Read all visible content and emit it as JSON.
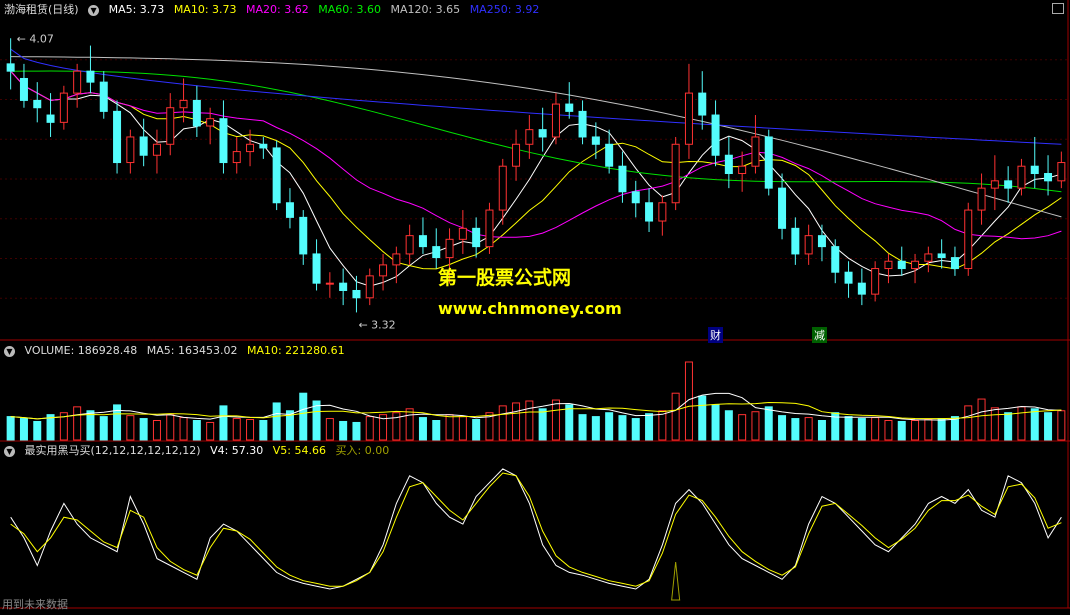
{
  "price_header": {
    "title": "渤海租赁(日线)",
    "ma5": "MA5: 3.73",
    "ma10": "MA10: 3.73",
    "ma20": "MA20: 3.62",
    "ma60": "MA60: 3.60",
    "ma120": "MA120: 3.65",
    "ma250": "MA250: 3.92"
  },
  "volume_header": {
    "label": "VOLUME: 186928.48",
    "ma5": "MA5: 163453.02",
    "ma10": "MA10: 221280.61"
  },
  "indicator_header": {
    "label": "最实用黑马买(12,12,12,12,12,12)",
    "v4": "V4: 57.30",
    "v5": "V5: 54.66",
    "buy": "买入: 0.00"
  },
  "annotations": {
    "high": "4.07",
    "low": "3.32",
    "tag1": "财",
    "tag2": "减"
  },
  "watermark": {
    "line1": "第一股票公式网",
    "line2": "www.chnmoney.com"
  },
  "footer": "用到未来数据",
  "colors": {
    "up": "#ff3232",
    "down": "#54fcfc",
    "ma5": "#ffffff",
    "ma10": "#ffff00",
    "ma20": "#ff00ff",
    "ma60": "#00e000",
    "ma120": "#c0c0c0",
    "ma250": "#3030ff"
  },
  "chart_data": {
    "type": "candlestick",
    "prices": [
      [
        4.0,
        4.07,
        3.93,
        3.98
      ],
      [
        3.96,
        4.0,
        3.88,
        3.9
      ],
      [
        3.9,
        3.95,
        3.84,
        3.88
      ],
      [
        3.86,
        3.92,
        3.8,
        3.84
      ],
      [
        3.84,
        3.94,
        3.82,
        3.92
      ],
      [
        3.92,
        4.0,
        3.88,
        3.98
      ],
      [
        3.98,
        4.05,
        3.92,
        3.95
      ],
      [
        3.95,
        3.98,
        3.85,
        3.87
      ],
      [
        3.87,
        3.9,
        3.7,
        3.73
      ],
      [
        3.73,
        3.82,
        3.7,
        3.8
      ],
      [
        3.8,
        3.85,
        3.72,
        3.75
      ],
      [
        3.75,
        3.82,
        3.7,
        3.78
      ],
      [
        3.78,
        3.92,
        3.75,
        3.88
      ],
      [
        3.88,
        3.96,
        3.84,
        3.9
      ],
      [
        3.9,
        3.94,
        3.8,
        3.83
      ],
      [
        3.83,
        3.88,
        3.78,
        3.85
      ],
      [
        3.85,
        3.9,
        3.7,
        3.73
      ],
      [
        3.73,
        3.8,
        3.7,
        3.76
      ],
      [
        3.76,
        3.82,
        3.72,
        3.78
      ],
      [
        3.78,
        3.8,
        3.74,
        3.77
      ],
      [
        3.77,
        3.79,
        3.6,
        3.62
      ],
      [
        3.62,
        3.66,
        3.55,
        3.58
      ],
      [
        3.58,
        3.6,
        3.45,
        3.48
      ],
      [
        3.48,
        3.52,
        3.38,
        3.4
      ],
      [
        3.4,
        3.43,
        3.36,
        3.4
      ],
      [
        3.4,
        3.44,
        3.34,
        3.38
      ],
      [
        3.38,
        3.42,
        3.32,
        3.36
      ],
      [
        3.36,
        3.44,
        3.34,
        3.42
      ],
      [
        3.42,
        3.48,
        3.38,
        3.45
      ],
      [
        3.45,
        3.5,
        3.4,
        3.48
      ],
      [
        3.48,
        3.56,
        3.45,
        3.53
      ],
      [
        3.53,
        3.58,
        3.48,
        3.5
      ],
      [
        3.5,
        3.55,
        3.44,
        3.47
      ],
      [
        3.47,
        3.55,
        3.4,
        3.52
      ],
      [
        3.52,
        3.6,
        3.48,
        3.55
      ],
      [
        3.55,
        3.58,
        3.47,
        3.5
      ],
      [
        3.5,
        3.62,
        3.48,
        3.6
      ],
      [
        3.6,
        3.74,
        3.56,
        3.72
      ],
      [
        3.72,
        3.82,
        3.68,
        3.78
      ],
      [
        3.78,
        3.86,
        3.74,
        3.82
      ],
      [
        3.82,
        3.88,
        3.76,
        3.8
      ],
      [
        3.8,
        3.92,
        3.78,
        3.89
      ],
      [
        3.89,
        3.95,
        3.85,
        3.87
      ],
      [
        3.87,
        3.9,
        3.78,
        3.8
      ],
      [
        3.8,
        3.84,
        3.74,
        3.78
      ],
      [
        3.78,
        3.82,
        3.7,
        3.72
      ],
      [
        3.72,
        3.76,
        3.62,
        3.65
      ],
      [
        3.65,
        3.68,
        3.58,
        3.62
      ],
      [
        3.62,
        3.66,
        3.54,
        3.57
      ],
      [
        3.57,
        3.64,
        3.53,
        3.62
      ],
      [
        3.62,
        3.8,
        3.6,
        3.78
      ],
      [
        3.78,
        4.0,
        3.74,
        3.92
      ],
      [
        3.92,
        3.98,
        3.82,
        3.86
      ],
      [
        3.86,
        3.9,
        3.72,
        3.75
      ],
      [
        3.75,
        3.8,
        3.66,
        3.7
      ],
      [
        3.7,
        3.76,
        3.65,
        3.72
      ],
      [
        3.72,
        3.86,
        3.7,
        3.8
      ],
      [
        3.8,
        3.82,
        3.64,
        3.66
      ],
      [
        3.66,
        3.7,
        3.52,
        3.55
      ],
      [
        3.55,
        3.58,
        3.45,
        3.48
      ],
      [
        3.48,
        3.56,
        3.45,
        3.53
      ],
      [
        3.53,
        3.56,
        3.46,
        3.5
      ],
      [
        3.5,
        3.52,
        3.4,
        3.43
      ],
      [
        3.43,
        3.46,
        3.36,
        3.4
      ],
      [
        3.4,
        3.44,
        3.34,
        3.37
      ],
      [
        3.37,
        3.46,
        3.35,
        3.44
      ],
      [
        3.44,
        3.48,
        3.4,
        3.46
      ],
      [
        3.46,
        3.5,
        3.42,
        3.44
      ],
      [
        3.44,
        3.48,
        3.4,
        3.46
      ],
      [
        3.46,
        3.5,
        3.43,
        3.48
      ],
      [
        3.48,
        3.52,
        3.44,
        3.47
      ],
      [
        3.47,
        3.5,
        3.42,
        3.44
      ],
      [
        3.44,
        3.62,
        3.42,
        3.6
      ],
      [
        3.6,
        3.7,
        3.56,
        3.66
      ],
      [
        3.66,
        3.75,
        3.6,
        3.68
      ],
      [
        3.68,
        3.72,
        3.62,
        3.66
      ],
      [
        3.66,
        3.74,
        3.64,
        3.72
      ],
      [
        3.72,
        3.8,
        3.66,
        3.7
      ],
      [
        3.7,
        3.75,
        3.64,
        3.68
      ],
      [
        3.68,
        3.76,
        3.66,
        3.73
      ]
    ],
    "volume": [
      120,
      110,
      95,
      130,
      140,
      170,
      150,
      120,
      180,
      125,
      110,
      100,
      130,
      115,
      100,
      90,
      175,
      110,
      105,
      100,
      190,
      150,
      240,
      200,
      110,
      95,
      90,
      120,
      130,
      140,
      160,
      115,
      100,
      130,
      120,
      105,
      140,
      175,
      190,
      200,
      160,
      205,
      180,
      130,
      120,
      140,
      125,
      110,
      135,
      150,
      240,
      400,
      225,
      180,
      150,
      130,
      145,
      170,
      125,
      110,
      115,
      100,
      140,
      120,
      110,
      115,
      100,
      95,
      100,
      105,
      110,
      120,
      175,
      210,
      165,
      140,
      170,
      160,
      140,
      150
    ],
    "v4": [
      60,
      45,
      25,
      50,
      70,
      55,
      45,
      40,
      35,
      75,
      55,
      30,
      25,
      20,
      15,
      45,
      55,
      50,
      40,
      30,
      20,
      15,
      12,
      10,
      8,
      10,
      15,
      20,
      40,
      70,
      90,
      85,
      70,
      60,
      55,
      75,
      85,
      95,
      90,
      70,
      40,
      25,
      20,
      18,
      15,
      12,
      10,
      8,
      15,
      40,
      70,
      80,
      70,
      55,
      40,
      30,
      25,
      20,
      15,
      25,
      55,
      75,
      70,
      60,
      50,
      40,
      35,
      45,
      55,
      70,
      75,
      70,
      80,
      65,
      60,
      90,
      85,
      70,
      45,
      60
    ],
    "v5": [
      55,
      48,
      35,
      45,
      60,
      58,
      50,
      42,
      38,
      65,
      60,
      38,
      28,
      22,
      18,
      38,
      52,
      50,
      44,
      34,
      24,
      18,
      14,
      12,
      10,
      10,
      14,
      20,
      35,
      60,
      82,
      85,
      75,
      65,
      58,
      70,
      82,
      92,
      90,
      75,
      50,
      32,
      24,
      20,
      17,
      14,
      12,
      10,
      14,
      34,
      62,
      76,
      72,
      60,
      46,
      35,
      28,
      22,
      18,
      24,
      48,
      68,
      70,
      62,
      54,
      45,
      38,
      44,
      52,
      65,
      72,
      72,
      76,
      68,
      62,
      82,
      84,
      74,
      52,
      56
    ],
    "buy_signal_index": 50,
    "price_axis": [
      3.25,
      4.12
    ],
    "labels": {
      "high": 4.07,
      "low": 3.32
    }
  }
}
